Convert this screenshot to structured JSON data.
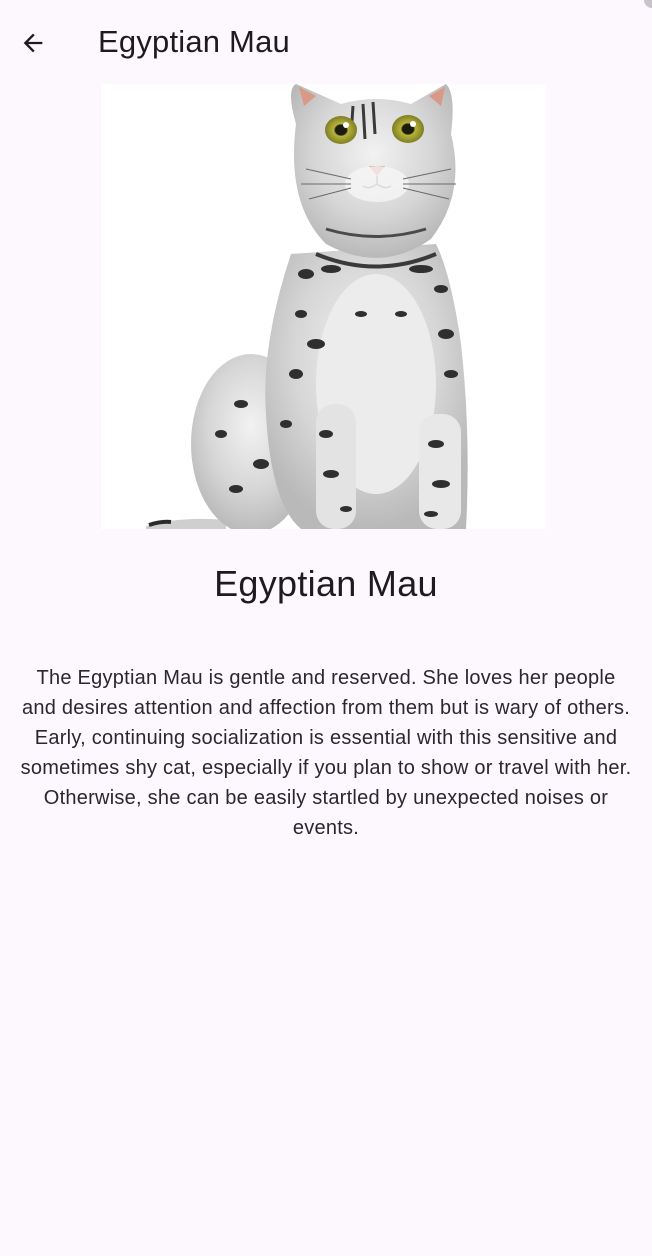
{
  "app_bar": {
    "back_icon": "arrow-back-icon",
    "title": "Egyptian Mau"
  },
  "hero_image": {
    "subject": "silver spotted cat sitting, white background"
  },
  "breed": {
    "name": "Egyptian Mau",
    "description": "The Egyptian Mau is gentle and reserved. She loves her people and desires attention and affection from them but is wary of others. Early, continuing socialization is essential with this sensitive and sometimes shy cat, especially if you plan to show or travel with her. Otherwise, she can be easily startled by unexpected noises or events."
  },
  "colors": {
    "background": "#fdf7fe",
    "text": "#1d1b20"
  }
}
